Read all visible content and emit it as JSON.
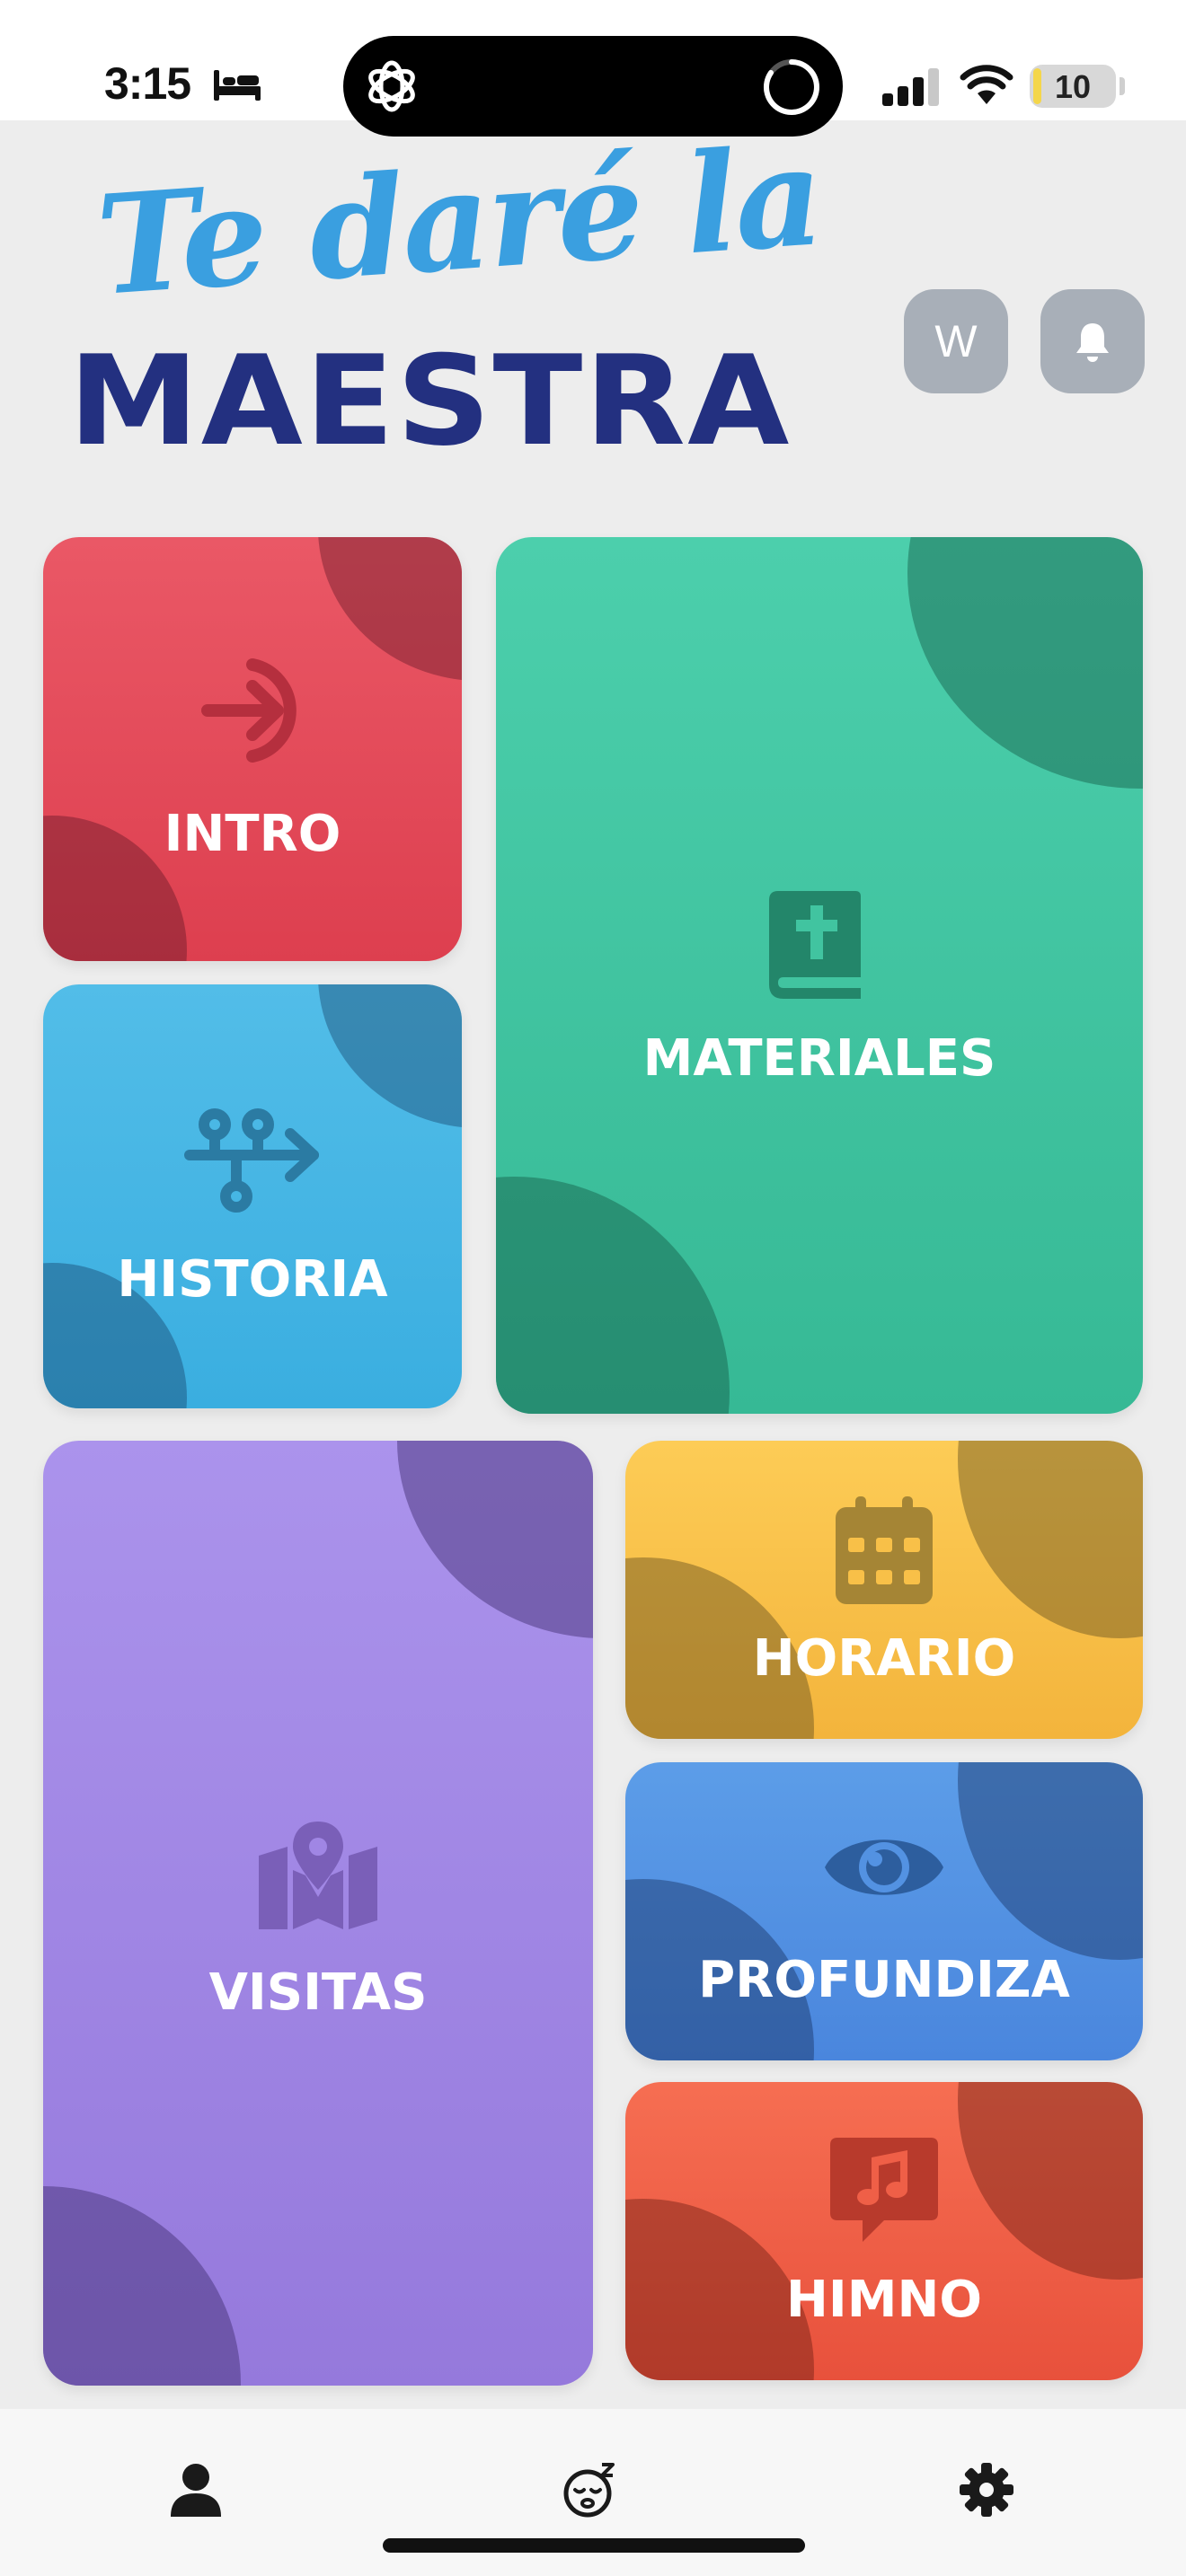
{
  "status_bar": {
    "time": "3:15",
    "battery_level": "10",
    "battery_fraction": 0.1,
    "icons": [
      "bed-icon",
      "chatgpt-logo-icon",
      "activity-ring-icon",
      "cellular-signal-icon",
      "wifi-icon",
      "battery-icon"
    ]
  },
  "header": {
    "logo_line1": "Te daré la",
    "logo_line2": "MAESTRA",
    "avatar_initial": "W",
    "notification_icon": "bell-icon"
  },
  "tiles": {
    "intro": {
      "label": "INTRO",
      "icon": "arrow-into-circle-icon",
      "color": "#e54b5a"
    },
    "historia": {
      "label": "HISTORIA",
      "icon": "timeline-arrow-icon",
      "color": "#45b5e4"
    },
    "materiales": {
      "label": "MATERIALES",
      "icon": "bible-icon",
      "color": "#41c4a0"
    },
    "visitas": {
      "label": "VISITAS",
      "icon": "map-pin-icon",
      "color": "#a086e4"
    },
    "horario": {
      "label": "HORARIO",
      "icon": "calendar-icon",
      "color": "#f8c048"
    },
    "profundiza": {
      "label": "PROFUNDIZA",
      "icon": "eye-icon",
      "color": "#5392e2"
    },
    "himno": {
      "label": "HIMNO",
      "icon": "music-note-icon",
      "color": "#ef5f47"
    }
  },
  "tab_bar": {
    "items": [
      {
        "icon": "profile-icon"
      },
      {
        "icon": "sleeping-face-icon"
      },
      {
        "icon": "gear-icon"
      }
    ]
  },
  "colors": {
    "background": "#ededed",
    "logo_script": "#3a9fe0",
    "logo_bold": "#233080",
    "header_buttons": "#a8afb8"
  }
}
